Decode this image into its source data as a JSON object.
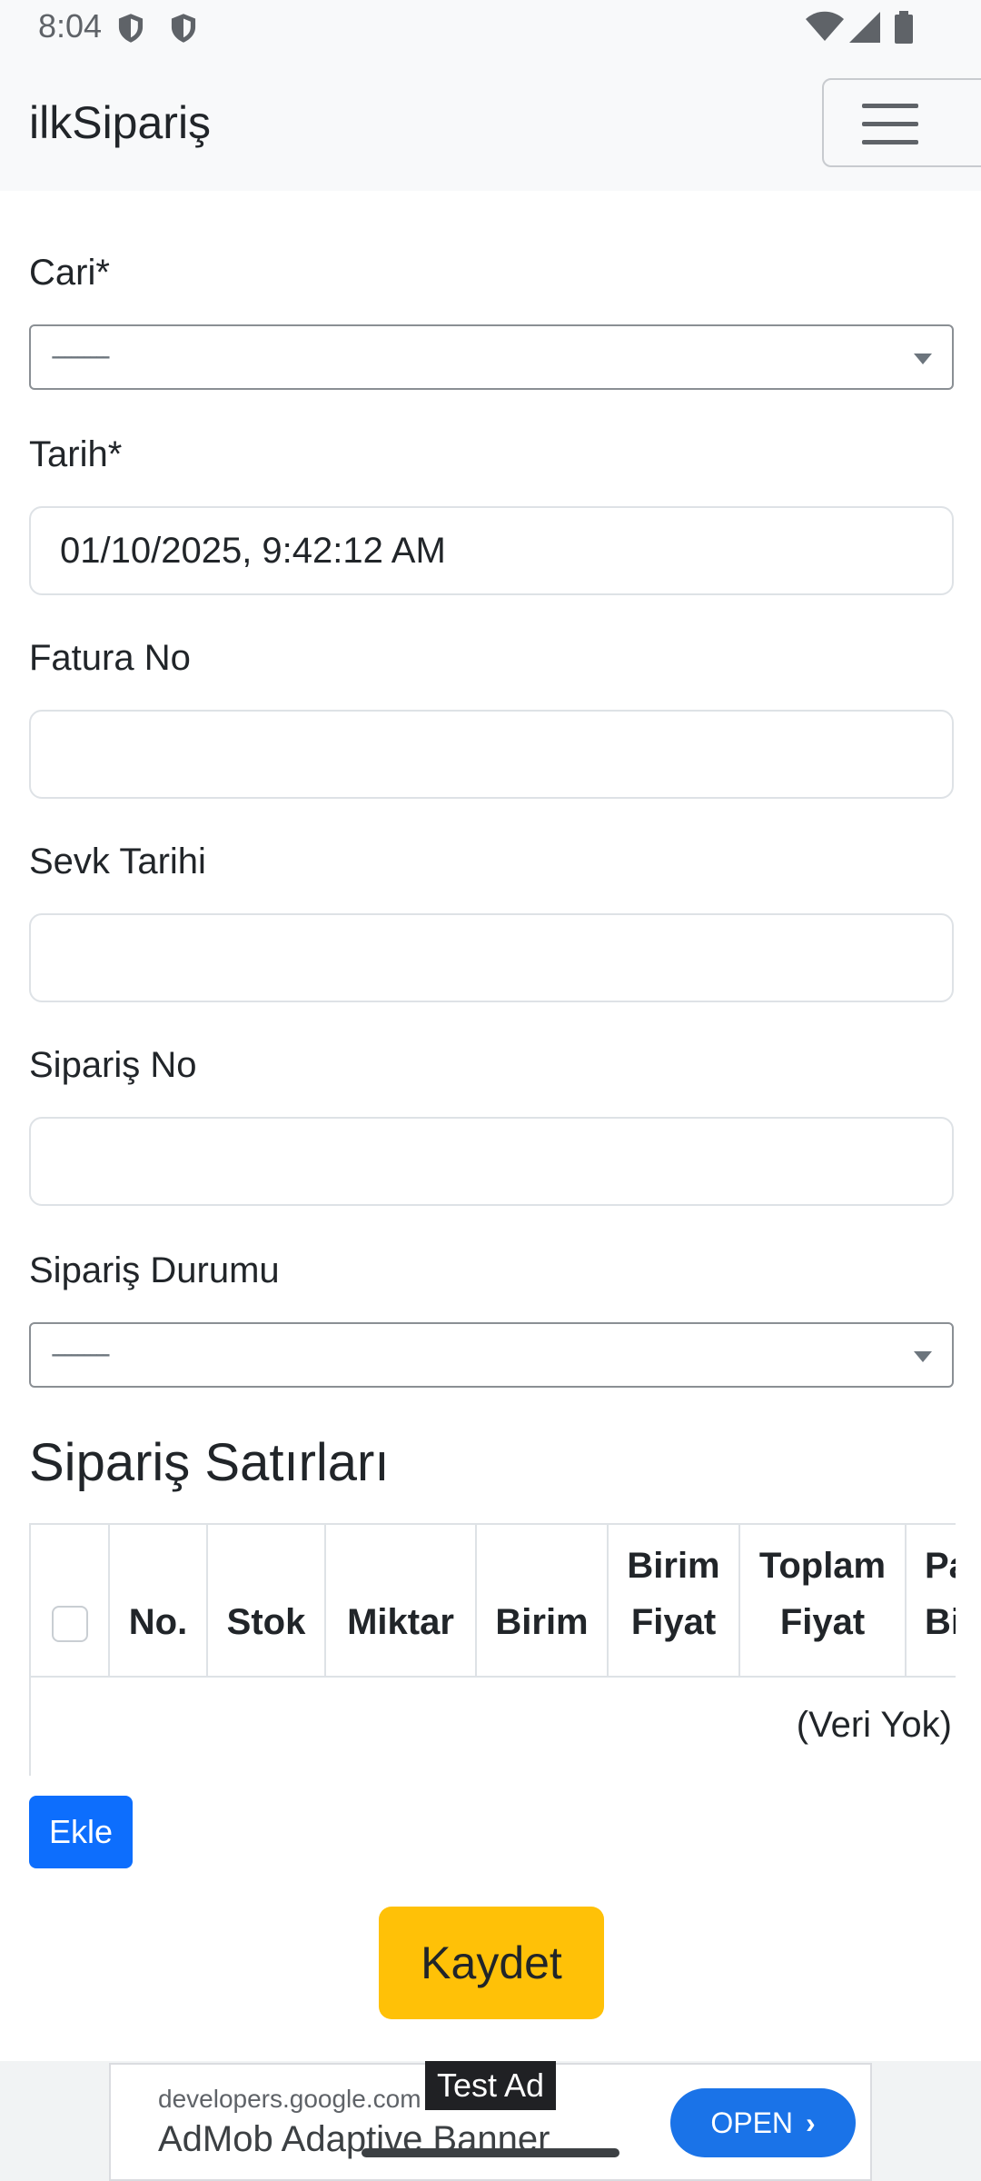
{
  "status_bar": {
    "time": "8:04",
    "icons": [
      "shield-icon",
      "shield-icon",
      "wifi-icon",
      "signal-icon",
      "battery-icon"
    ]
  },
  "navbar": {
    "brand": "ilkSipariş",
    "menu_icon": "hamburger-menu-icon"
  },
  "form": {
    "cari": {
      "label": "Cari*",
      "value": "---------"
    },
    "tarih": {
      "label": "Tarih*",
      "value": "01/10/2025, 9:42:12 AM"
    },
    "fatura_no": {
      "label": "Fatura No",
      "value": ""
    },
    "sevk_tarihi": {
      "label": "Sevk Tarihi",
      "value": ""
    },
    "siparis_no": {
      "label": "Sipariş No",
      "value": ""
    },
    "siparis_durumu": {
      "label": "Sipariş Durumu",
      "value": "---------"
    }
  },
  "lines": {
    "title": "Sipariş Satırları",
    "columns": {
      "no": "No.",
      "stok": "Stok",
      "miktar": "Miktar",
      "birim": "Birim",
      "birim_fiyat": "Birim Fiyat",
      "toplam_fiyat": "Toplam Fiyat",
      "para_birimi": "Para Birimi"
    },
    "empty_text": "(Veri Yok)",
    "add_label": "Ekle"
  },
  "save_label": "Kaydet",
  "ad": {
    "badge": "Test Ad",
    "domain": "developers.google.com",
    "headline": "AdMob Adaptive Banner",
    "cta": "OPEN"
  },
  "colors": {
    "primary": "#0d6efd",
    "warning": "#ffc107",
    "navbar_bg": "#f8f9fa",
    "ad_cta": "#1a73e8"
  }
}
